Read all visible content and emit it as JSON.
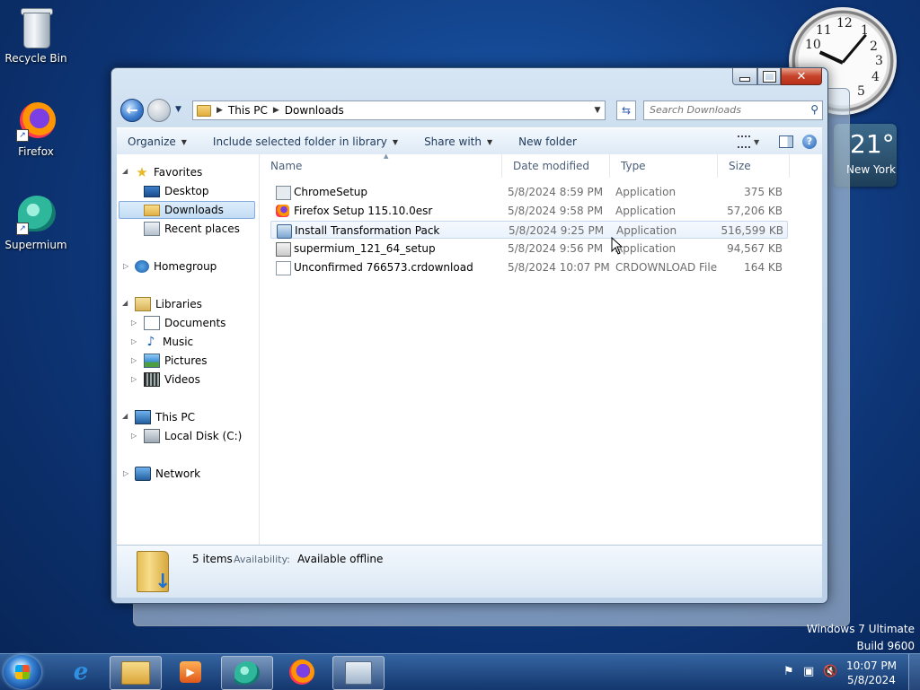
{
  "desktop": {
    "icons": [
      {
        "label": "Recycle Bin",
        "icon": "recycle-bin-icon"
      },
      {
        "label": "Firefox",
        "icon": "firefox-icon"
      },
      {
        "label": "Supermium",
        "icon": "supermium-icon"
      }
    ]
  },
  "gadgets": {
    "clock_numbers": [
      "12",
      "1",
      "2",
      "3",
      "4",
      "5",
      "10",
      "11"
    ],
    "weather_temp": "21°",
    "weather_city": "New York"
  },
  "os_info": {
    "edition": "Windows 7 Ultimate",
    "build": "Build 9600"
  },
  "explorer": {
    "address": {
      "crumbs": [
        "This PC",
        "Downloads"
      ]
    },
    "search_placeholder": "Search Downloads",
    "commands": {
      "organize": "Organize",
      "include": "Include selected folder in library",
      "share": "Share with",
      "new_folder": "New folder"
    },
    "nav": {
      "favorites": "Favorites",
      "desktop": "Desktop",
      "downloads": "Downloads",
      "recent": "Recent places",
      "homegroup": "Homegroup",
      "libraries": "Libraries",
      "documents": "Documents",
      "music": "Music",
      "pictures": "Pictures",
      "videos": "Videos",
      "this_pc": "This PC",
      "local_disk": "Local Disk (C:)",
      "network": "Network"
    },
    "columns": {
      "name": "Name",
      "date": "Date modified",
      "type": "Type",
      "size": "Size"
    },
    "files": [
      {
        "name": "ChromeSetup",
        "date": "5/8/2024 8:59 PM",
        "type": "Application",
        "size": "375 KB",
        "icon": "chrome-setup-icon"
      },
      {
        "name": "Firefox Setup 115.10.0esr",
        "date": "5/8/2024 9:58 PM",
        "type": "Application",
        "size": "57,206 KB",
        "icon": "firefox-setup-icon"
      },
      {
        "name": "Install Transformation Pack",
        "date": "5/8/2024 9:25 PM",
        "type": "Application",
        "size": "516,599 KB",
        "icon": "installer-icon"
      },
      {
        "name": "supermium_121_64_setup",
        "date": "5/8/2024 9:56 PM",
        "type": "Application",
        "size": "94,567 KB",
        "icon": "exe-icon"
      },
      {
        "name": "Unconfirmed 766573.crdownload",
        "date": "5/8/2024 10:07 PM",
        "type": "CRDOWNLOAD File",
        "size": "164 KB",
        "icon": "file-icon"
      }
    ],
    "details": {
      "count": "5 items",
      "availability_label": "Availability:",
      "availability_value": "Available offline"
    }
  },
  "taskbar": {
    "time": "10:07 PM",
    "date": "5/8/2024"
  }
}
